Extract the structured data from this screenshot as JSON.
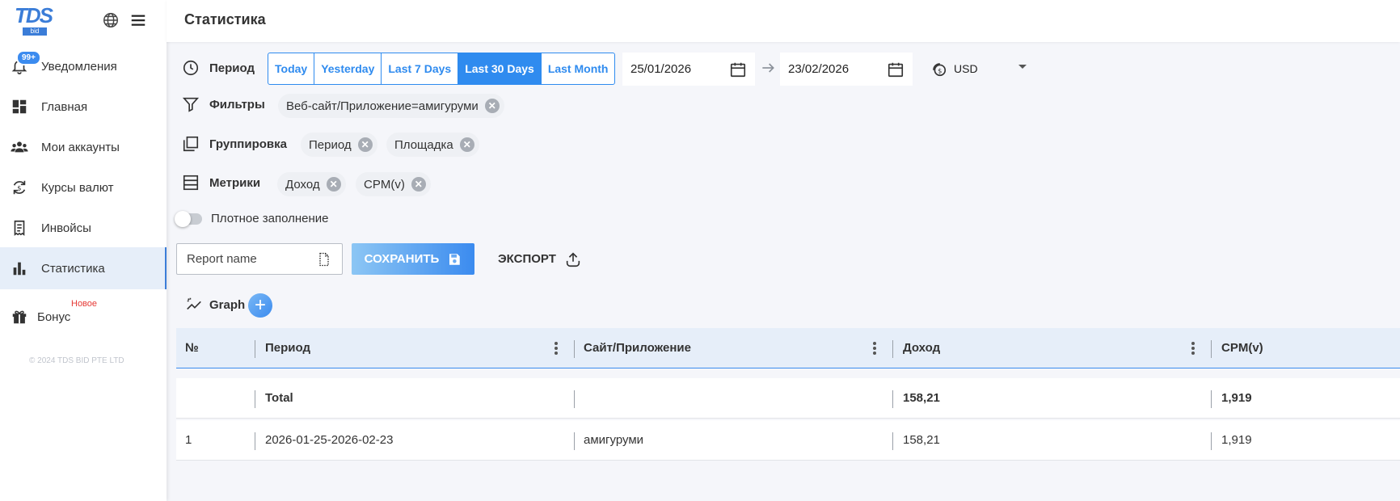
{
  "sidebar": {
    "logo_text": "TDS",
    "logo_sub": "bid",
    "items": [
      {
        "label": "Уведомления",
        "badge": "99+"
      },
      {
        "label": "Главная"
      },
      {
        "label": "Мои аккаунты"
      },
      {
        "label": "Курсы валют"
      },
      {
        "label": "Инвойсы"
      },
      {
        "label": "Статистика",
        "active": true
      },
      {
        "label": "Бонус",
        "tag": "Новое"
      }
    ],
    "copyright": "© 2024 TDS BID PTE LTD"
  },
  "header": {
    "title": "Статистика"
  },
  "period": {
    "label": "Период",
    "buttons": [
      "Today",
      "Yesterday",
      "Last 7 Days",
      "Last 30 Days",
      "Last Month"
    ],
    "active": "Last 30 Days",
    "date_from": "25/01/2026",
    "date_to": "23/02/2026",
    "currency": "USD"
  },
  "filters": {
    "label": "Фильтры",
    "chips": [
      "Веб-сайт/Приложение=амигуруми"
    ]
  },
  "grouping": {
    "label": "Группировка",
    "chips": [
      "Период",
      "Площадка"
    ]
  },
  "metrics": {
    "label": "Метрики",
    "chips": [
      "Доход",
      "CPM(v)"
    ]
  },
  "dense": {
    "label": "Плотное заполнение",
    "enabled": false
  },
  "report": {
    "placeholder": "Report name",
    "save_label": "СОХРАНИТЬ",
    "export_label": "ЭКСПОРТ"
  },
  "graph": {
    "label": "Graph",
    "add_symbol": "+"
  },
  "table": {
    "columns": [
      "№",
      "Период",
      "Сайт/Приложение",
      "Доход",
      "CPM(v)"
    ],
    "total": {
      "label": "Total",
      "revenue": "158,21",
      "cpm": "1,919"
    },
    "rows": [
      {
        "num": "1",
        "period": "2026-01-25-2026-02-23",
        "site": "амигуруми",
        "revenue": "158,21",
        "cpm": "1,919"
      }
    ]
  },
  "colors": {
    "accent": "#2f8bef",
    "active_bg": "#e6eef9",
    "new_tag": "#e53935"
  }
}
